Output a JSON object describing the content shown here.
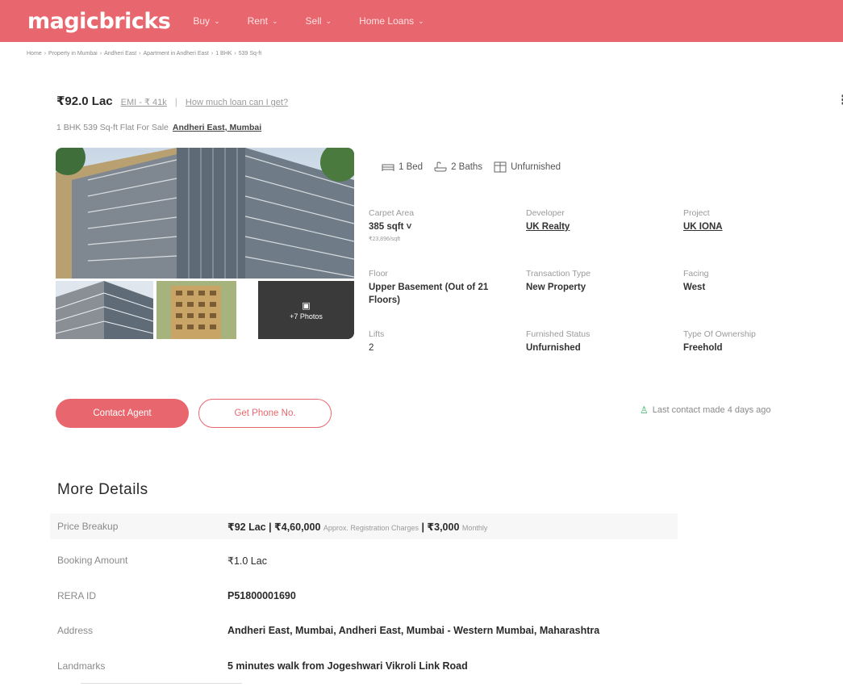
{
  "header": {
    "logo": "magicbricks",
    "nav": [
      {
        "label": "Buy"
      },
      {
        "label": "Rent"
      },
      {
        "label": "Sell"
      },
      {
        "label": "Home Loans"
      }
    ]
  },
  "breadcrumb": [
    "Home",
    "Property in Mumbai",
    "Andheri East",
    "Apartment in Andheri East",
    "1 BHK",
    "539 Sq-ft"
  ],
  "listing": {
    "price": "₹92.0 Lac",
    "emi": "EMI - ₹ 41k",
    "separator": "|",
    "loan_link": "How much loan can I get?",
    "subtitle": "1 BHK 539 Sq-ft Flat For Sale",
    "location": "Andheri East, Mumbai",
    "photos_label": "+7 Photos",
    "features": {
      "beds": "1 Bed",
      "baths": "2 Baths",
      "furnishing": "Unfurnished"
    },
    "specs": {
      "carpet_area_label": "Carpet Area",
      "carpet_area_value": "385 sqft ˅",
      "carpet_area_rate": "₹23,896/sqft",
      "developer_label": "Developer",
      "developer_value": "UK Realty",
      "project_label": "Project",
      "project_value": "UK IONA",
      "floor_label": "Floor",
      "floor_value": "Upper Basement (Out of 21 Floors)",
      "transaction_label": "Transaction Type",
      "transaction_value": "New Property",
      "facing_label": "Facing",
      "facing_value": "West",
      "lifts_label": "Lifts",
      "lifts_value": "2",
      "furnished_label": "Furnished Status",
      "furnished_value": "Unfurnished",
      "ownership_label": "Type Of Ownership",
      "ownership_value": "Freehold"
    },
    "contact_button": "Contact Agent",
    "phone_button": "Get Phone No.",
    "last_contact": "Last contact made 4 days ago"
  },
  "more_details": {
    "title": "More Details",
    "price_breakup_label": "Price Breakup",
    "price_breakup_main": "₹92 Lac | ₹4,60,000",
    "price_breakup_note": "Approx. Registration Charges",
    "price_breakup_sep": "| ₹3,000",
    "price_breakup_monthly": "Monthly",
    "booking_label": "Booking Amount",
    "booking_value": "₹1.0 Lac",
    "rera_label": "RERA ID",
    "rera_value": "P51800001690",
    "address_label": "Address",
    "address_value": "Andheri East, Mumbai, Andheri East, Mumbai - Western Mumbai, Maharashtra",
    "landmarks_label": "Landmarks",
    "landmarks_value": "5 minutes walk from Jogeshwari Vikroli Link Road"
  },
  "colors": {
    "brand": "#e8676e",
    "success": "#3ab06b"
  }
}
